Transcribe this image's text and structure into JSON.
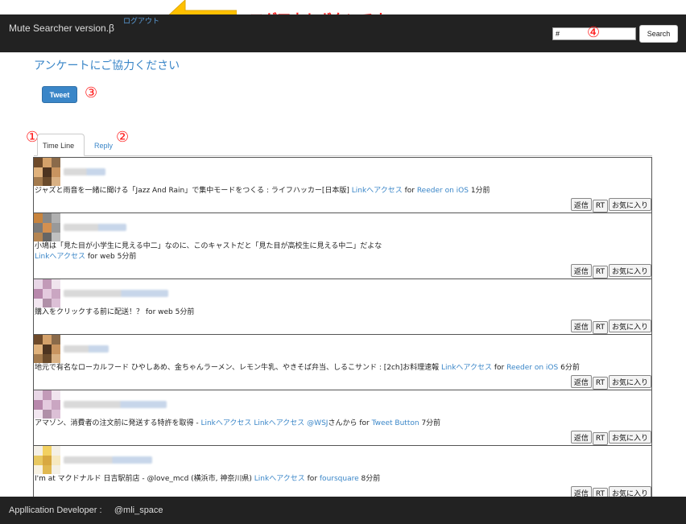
{
  "header": {
    "brand": "Mute Searcher version.β",
    "logout_label": "ログアウト",
    "search_placeholder": "#",
    "search_value": "#",
    "search_button": "Search"
  },
  "annotations": {
    "logout_note": "ログアウトボタンです",
    "num1": "①",
    "num2": "②",
    "num3": "③",
    "num4": "④",
    "color": "#ff1a1a"
  },
  "survey": {
    "title": "アンケートにご協力ください",
    "tweet_button": "Tweet"
  },
  "tabs": {
    "timeline": "Time Line",
    "reply": "Reply"
  },
  "tweets": [
    {
      "avatar": "avatar-orange",
      "text": "ジャズと雨音を一緒に聞ける「Jazz And Rain」で集中モードをつくる : ライフハッカー[日本版]",
      "link": "Linkへアクセス",
      "for_label": "for",
      "source": "Reeder on iOS",
      "time": "1分前"
    },
    {
      "avatar": "avatar-orange-gray",
      "text": "小鳩は「見た目が小学生に見える中二」なのに、このキャストだと「見た目が高校生に見える中二」だよな",
      "link": "Linkへアクセス",
      "for_label": "for web",
      "source": "",
      "time": "5分前"
    },
    {
      "avatar": "avatar-pink",
      "text": "購入をクリックする前に配送！？",
      "link": "",
      "for_label": "for web",
      "source": "",
      "time": "5分前"
    },
    {
      "avatar": "avatar-orange",
      "text": "地元で有名なローカルフード ひやしあめ、金ちゃんラーメン、レモン牛乳、やきそば弁当、しるこサンド : [2ch]お料理速報",
      "link": "Linkへアクセス",
      "for_label": "for",
      "source": "Reeder on iOS",
      "time": "6分前"
    },
    {
      "avatar": "avatar-pink",
      "text": "アマゾン、消費者の注文前に発送する特許を取得 -",
      "link": "Linkへアクセス",
      "link2": "Linkへアクセス",
      "mention": "@WSJ",
      "after_mention": "さんから",
      "for_label": "for",
      "source": "Tweet Button",
      "time": "7分前"
    },
    {
      "avatar": "avatar-yellow",
      "text": "I'm at マクドナルド 日吉駅前店 - @love_mcd (横浜市, 神奈川県)",
      "link": "Linkへアクセス",
      "for_label": "for",
      "source": "foursquare",
      "time": "8分前"
    }
  ],
  "actions": {
    "reply": "返信",
    "rt": "RT",
    "fav": "お気に入り"
  },
  "footer": {
    "developer_label": "Appllication Developer :",
    "developer_handle": "@mli_space"
  },
  "colors": {
    "navbar": "#222222",
    "link": "#3a86c8",
    "annotation": "#ff1a1a"
  }
}
